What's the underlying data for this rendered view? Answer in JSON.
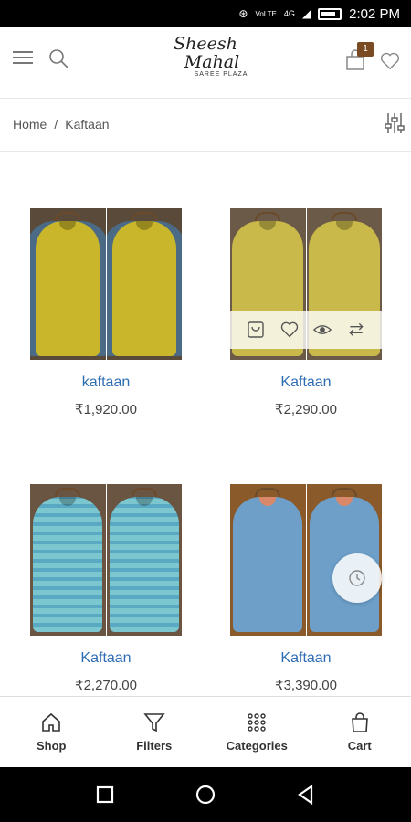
{
  "status_bar": {
    "time": "2:02 PM",
    "network": "VoLTE",
    "signal": "4G"
  },
  "header": {
    "logo_line1": "Sheesh",
    "logo_line2": "Mahal",
    "logo_line3": "SAREE PLAZA",
    "cart_count": "1"
  },
  "breadcrumb": {
    "home": "Home",
    "separator": "/",
    "current": "Kaftaan"
  },
  "products": [
    {
      "name": "kaftaan",
      "price": "₹1,920.00",
      "color": "#c9b62a",
      "accent": "#4b6a86"
    },
    {
      "name": "Kaftaan",
      "price": "₹2,290.00",
      "color": "#c9b84a",
      "accent": "#c9b84a"
    },
    {
      "name": "Kaftaan",
      "price": "₹2,270.00",
      "color": "#7cc7cf",
      "accent": "#7cc7cf"
    },
    {
      "name": "Kaftaan",
      "price": "₹3,390.00",
      "color": "#6d9fc9",
      "accent": "#d9886a"
    }
  ],
  "bottom_nav": {
    "shop": "Shop",
    "filters": "Filters",
    "categories": "Categories",
    "cart": "Cart"
  },
  "colors": {
    "link": "#2e6db4",
    "badge": "#7a4a22"
  }
}
